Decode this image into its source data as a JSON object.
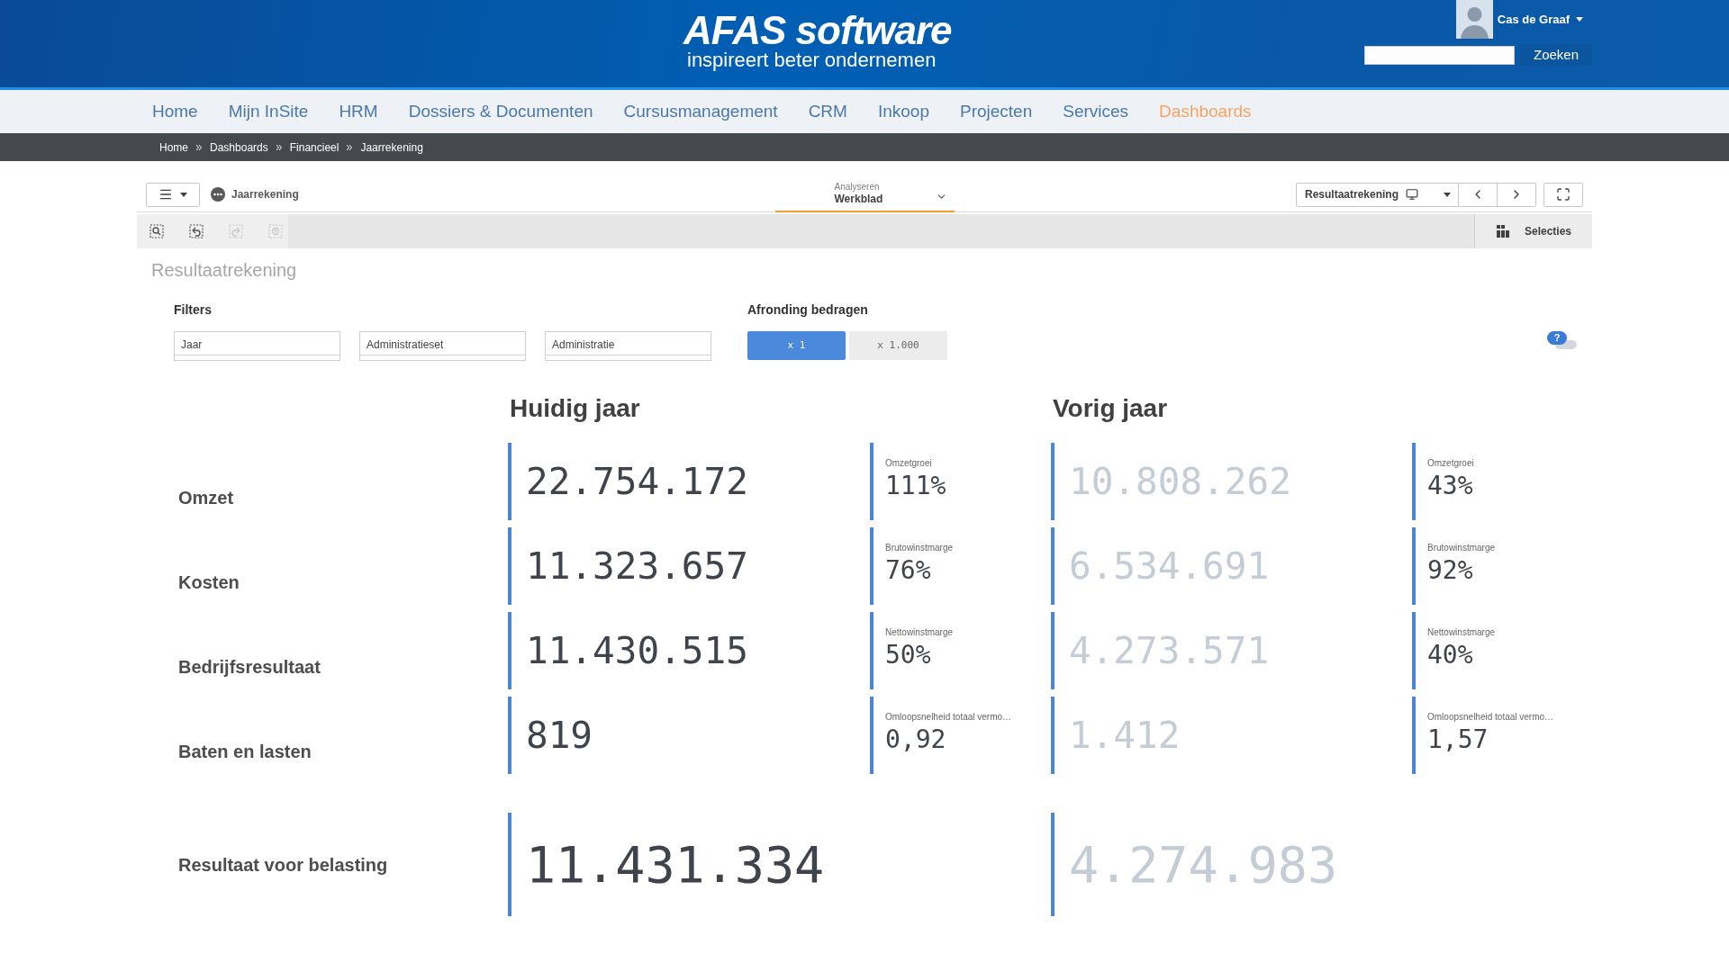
{
  "header": {
    "logo": "AFAS software",
    "tagline": "inspireert beter ondernemen",
    "user": "Cas de Graaf",
    "search_button": "Zoeken"
  },
  "nav": [
    {
      "label": "Home",
      "selected": false
    },
    {
      "label": "Mijn InSite",
      "selected": false
    },
    {
      "label": "HRM",
      "selected": false
    },
    {
      "label": "Dossiers & Documenten",
      "selected": false
    },
    {
      "label": "Cursusmanagement",
      "selected": false
    },
    {
      "label": "CRM",
      "selected": false
    },
    {
      "label": "Inkoop",
      "selected": false
    },
    {
      "label": "Projecten",
      "selected": false
    },
    {
      "label": "Services",
      "selected": false
    },
    {
      "label": "Dashboards",
      "selected": true
    }
  ],
  "breadcrumb": [
    "Home",
    "Dashboards",
    "Financieel",
    "Jaarrekening"
  ],
  "toolbar": {
    "app_title": "Jaarrekening",
    "mode": {
      "label": "Analyseren",
      "value": "Werkblad"
    },
    "sheet": "Resultaatrekening",
    "selection_tools": [
      {
        "kind": "search",
        "disabled": false
      },
      {
        "kind": "back",
        "disabled": false
      },
      {
        "kind": "forward",
        "disabled": true
      },
      {
        "kind": "clear",
        "disabled": true
      }
    ],
    "selections": "Selecties"
  },
  "sheet_title": "Resultaatrekening",
  "filters": {
    "label": "Filters",
    "fields": [
      {
        "placeholder": "Jaar"
      },
      {
        "placeholder": "Administratieset"
      },
      {
        "placeholder": "Administratie"
      }
    ]
  },
  "rounding": {
    "label": "Afronding bedragen",
    "options": [
      {
        "label": "x 1",
        "selected": true
      },
      {
        "label": "x 1.000",
        "selected": false
      }
    ]
  },
  "help": {
    "label": "?"
  },
  "columns": [
    {
      "title": "Huidig jaar",
      "kind": "current"
    },
    {
      "title": "Vorig jaar",
      "kind": "previous"
    }
  ],
  "rows": [
    {
      "kind": "kpi",
      "label": "Omzet",
      "cells": [
        {
          "value": "22.754.172",
          "ratio_label": "Omzetgroei",
          "ratio": "111%"
        },
        {
          "value": "10.808.262",
          "ratio_label": "Omzetgroei",
          "ratio": "43%"
        }
      ]
    },
    {
      "kind": "kpi",
      "label": "Kosten",
      "cells": [
        {
          "value": "11.323.657",
          "ratio_label": "Brutowinstmarge",
          "ratio": "76%"
        },
        {
          "value": "6.534.691",
          "ratio_label": "Brutowinstmarge",
          "ratio": "92%"
        }
      ]
    },
    {
      "kind": "kpi",
      "label": "Bedrijfsresultaat",
      "cells": [
        {
          "value": "11.430.515",
          "ratio_label": "Nettowinstmarge",
          "ratio": "50%"
        },
        {
          "value": "4.273.571",
          "ratio_label": "Nettowinstmarge",
          "ratio": "40%"
        }
      ]
    },
    {
      "kind": "kpi",
      "label": "Baten en lasten",
      "cells": [
        {
          "value": "819",
          "ratio_label": "Omloopsnelheid totaal vermo…",
          "ratio": "0,92"
        },
        {
          "value": "1.412",
          "ratio_label": "Omloopsnelheid totaal vermo…",
          "ratio": "1,57"
        }
      ]
    },
    {
      "kind": "total",
      "label": "Resultaat voor belasting",
      "cells": [
        {
          "value": "11.431.334"
        },
        {
          "value": "4.274.983"
        }
      ]
    }
  ]
}
